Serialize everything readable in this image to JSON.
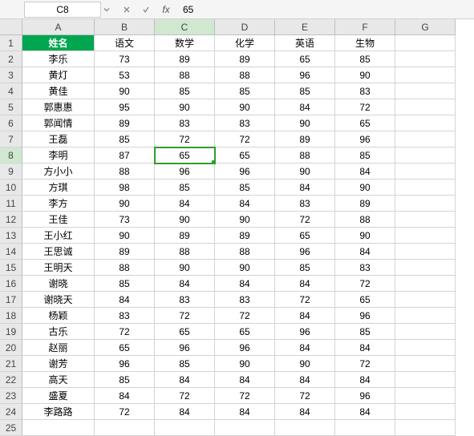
{
  "namebox": {
    "ref": "C8"
  },
  "formula_bar": {
    "fx_label": "fx",
    "value": "65"
  },
  "columns": [
    "A",
    "B",
    "C",
    "D",
    "E",
    "F",
    "G"
  ],
  "active_col_index": 2,
  "active_row": 8,
  "selected_cell": {
    "row": 8,
    "col": 2
  },
  "row_count": 25,
  "headers_row": {
    "A": "姓名",
    "B": "语文",
    "C": "数学",
    "D": "化学",
    "E": "英语",
    "F": "生物"
  },
  "chart_data": {
    "type": "table",
    "title": "",
    "columns": [
      "姓名",
      "语文",
      "数学",
      "化学",
      "英语",
      "生物"
    ],
    "rows": [
      [
        "李乐",
        73,
        89,
        89,
        65,
        85
      ],
      [
        "黄灯",
        53,
        88,
        88,
        96,
        90
      ],
      [
        "黄佳",
        90,
        85,
        85,
        85,
        83
      ],
      [
        "郭惠惠",
        95,
        90,
        90,
        84,
        72
      ],
      [
        "郭闻情",
        89,
        83,
        83,
        90,
        65
      ],
      [
        "王磊",
        85,
        72,
        72,
        89,
        96
      ],
      [
        "李明",
        87,
        65,
        65,
        88,
        85
      ],
      [
        "方小小",
        88,
        96,
        96,
        90,
        84
      ],
      [
        "方琪",
        98,
        85,
        85,
        84,
        90
      ],
      [
        "李方",
        90,
        84,
        84,
        83,
        89
      ],
      [
        "王佳",
        73,
        90,
        90,
        72,
        88
      ],
      [
        "王小红",
        90,
        89,
        89,
        65,
        90
      ],
      [
        "王思诚",
        89,
        88,
        88,
        96,
        84
      ],
      [
        "王明天",
        88,
        90,
        90,
        85,
        83
      ],
      [
        "谢晓",
        85,
        84,
        84,
        84,
        72
      ],
      [
        "谢晓天",
        84,
        83,
        83,
        72,
        65
      ],
      [
        "杨颖",
        83,
        72,
        72,
        84,
        96
      ],
      [
        "古乐",
        72,
        65,
        65,
        96,
        85
      ],
      [
        "赵丽",
        65,
        96,
        96,
        84,
        84
      ],
      [
        "谢芳",
        96,
        85,
        90,
        90,
        72
      ],
      [
        "高天",
        85,
        84,
        84,
        84,
        84
      ],
      [
        "盛夏",
        84,
        72,
        72,
        72,
        96
      ],
      [
        "李路路",
        72,
        84,
        84,
        84,
        84
      ]
    ]
  }
}
